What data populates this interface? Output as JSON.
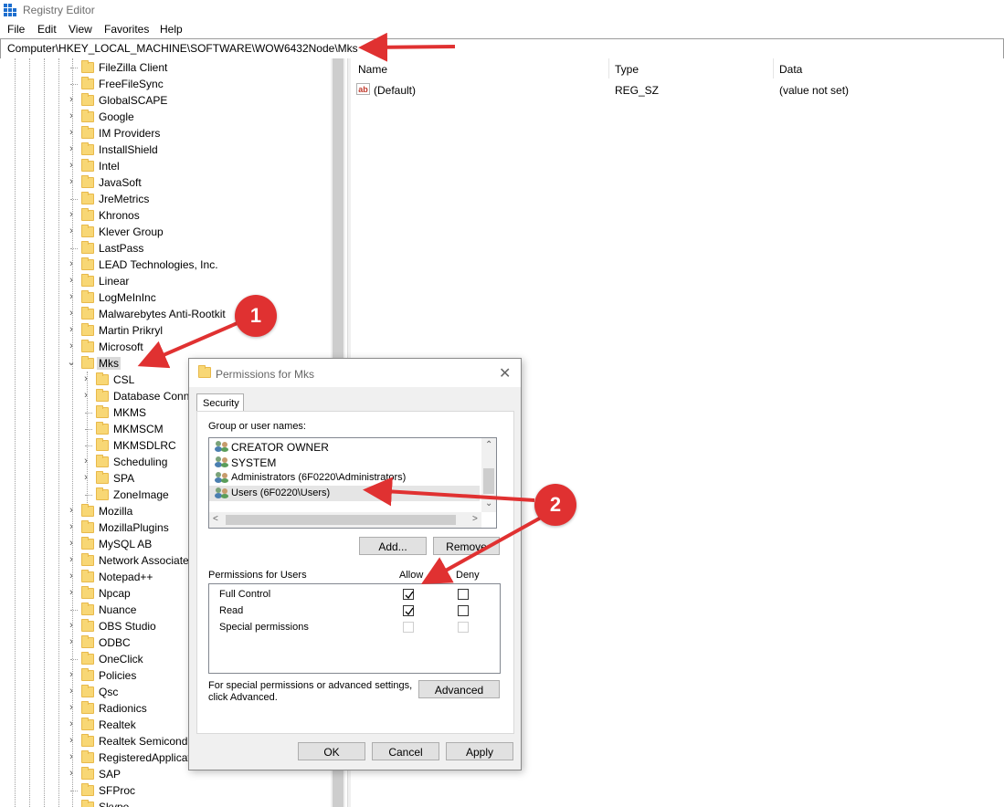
{
  "window": {
    "title": "Registry Editor"
  },
  "menu": [
    "File",
    "Edit",
    "View",
    "Favorites",
    "Help"
  ],
  "address": "Computer\\HKEY_LOCAL_MACHINE\\SOFTWARE\\WOW6432Node\\Mks",
  "tree": {
    "items": [
      "FileZilla Client",
      "FreeFileSync",
      "GlobalSCAPE",
      "Google",
      "IM Providers",
      "InstallShield",
      "Intel",
      "JavaSoft",
      "JreMetrics",
      "Khronos",
      "Klever Group",
      "LastPass",
      "LEAD Technologies, Inc.",
      "Linear",
      "LogMeInInc",
      "Malwarebytes Anti-Rootkit",
      "Martin Prikryl",
      "Microsoft",
      "Mks"
    ],
    "mks_children": [
      "CSL",
      "Database Conne",
      "MKMS",
      "MKMSCM",
      "MKMSDLRC",
      "Scheduling",
      "SPA",
      "ZoneImage"
    ],
    "after": [
      "Mozilla",
      "MozillaPlugins",
      "MySQL AB",
      "Network Associate",
      "Notepad++",
      "Npcap",
      "Nuance",
      "OBS Studio",
      "ODBC",
      "OneClick",
      "Policies",
      "Qsc",
      "Radionics",
      "Realtek",
      "Realtek Semicondu",
      "RegisteredApplicat",
      "SAP",
      "SFProc",
      "Skype"
    ]
  },
  "values": {
    "headers": {
      "name": "Name",
      "type": "Type",
      "data": "Data"
    },
    "row": {
      "name": "(Default)",
      "type": "REG_SZ",
      "data": "(value not set)",
      "icon_text": "ab"
    }
  },
  "dialog": {
    "title": "Permissions for Mks",
    "tab": "Security",
    "group_label": "Group or user names:",
    "users": [
      "CREATOR OWNER",
      "SYSTEM",
      "Administrators (6F0220\\Administrators)",
      "Users (6F0220\\Users)"
    ],
    "add_label": "Add...",
    "remove_label": "Remove",
    "perm_label": "Permissions for Users",
    "allow_label": "Allow",
    "deny_label": "Deny",
    "permissions": [
      {
        "name": "Full Control",
        "allow": true,
        "deny": false,
        "disabled": false
      },
      {
        "name": "Read",
        "allow": true,
        "deny": false,
        "disabled": false
      },
      {
        "name": "Special permissions",
        "allow": false,
        "deny": false,
        "disabled": true
      }
    ],
    "advanced_text_1": "For special permissions or advanced settings,",
    "advanced_text_2": "click Advanced.",
    "advanced_label": "Advanced",
    "ok_label": "OK",
    "cancel_label": "Cancel",
    "apply_label": "Apply"
  },
  "callouts": [
    "1",
    "2"
  ],
  "colors": {
    "callout": "#e03131",
    "folder": "#f8d775",
    "selection": "#d9d9d9"
  }
}
